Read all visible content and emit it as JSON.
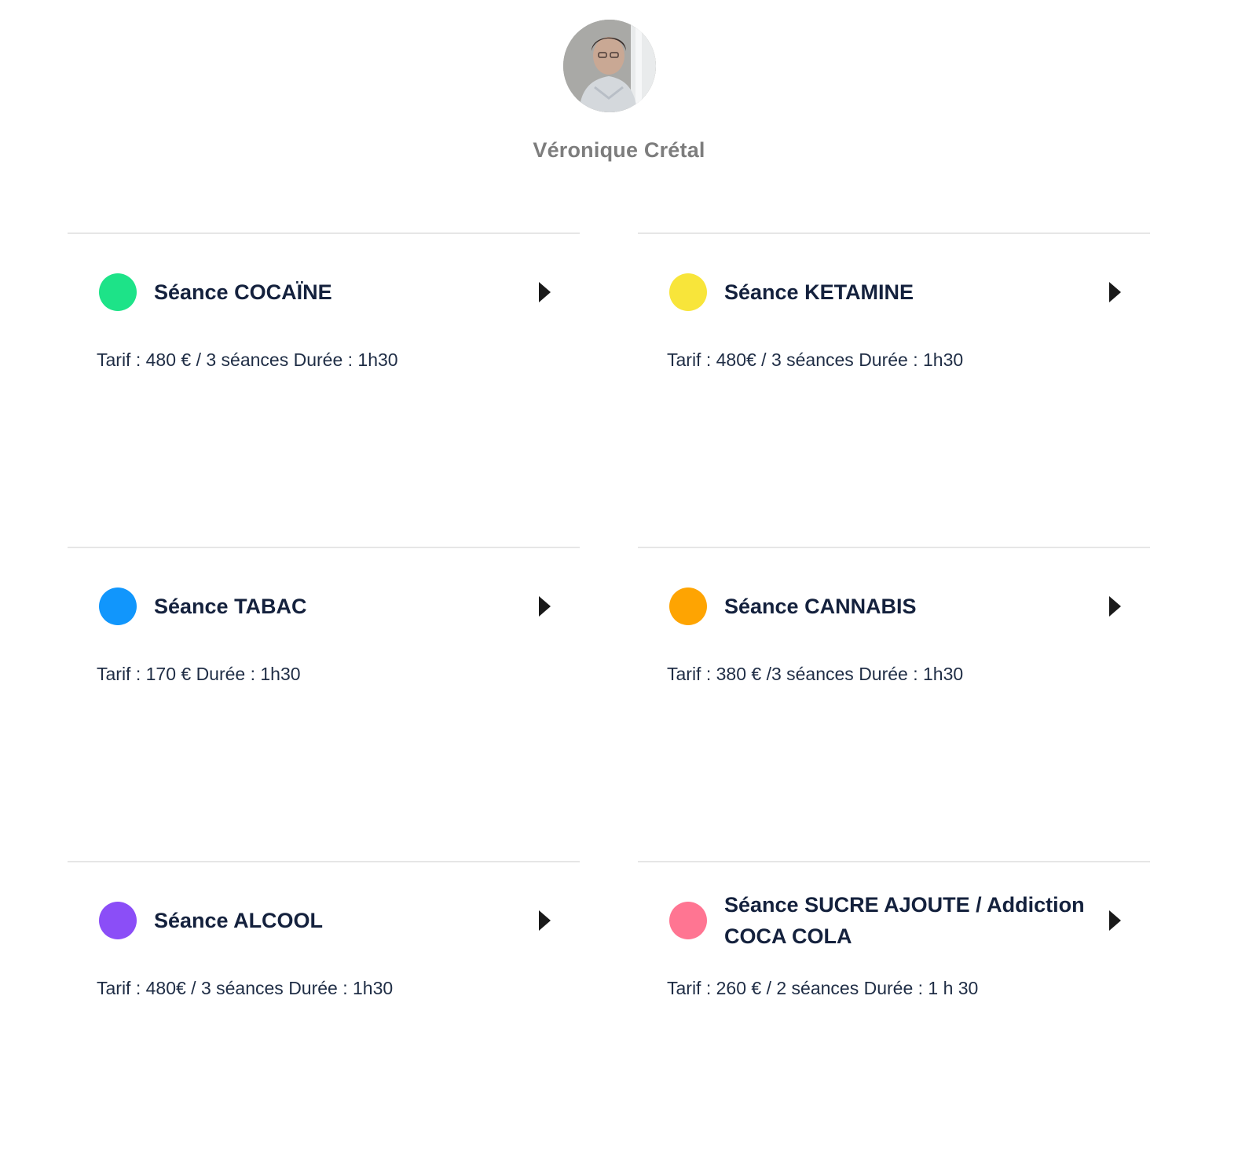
{
  "provider": {
    "name": "Véronique Crétal"
  },
  "services": [
    {
      "title": "Séance COCAÏNE",
      "description": "Tarif : 480 € / 3 séances Durée : 1h30",
      "dot_color": "#1de388",
      "icon": "chevron-right-icon"
    },
    {
      "title": "Séance KETAMINE",
      "description": "Tarif : 480€ / 3 séances Durée : 1h30",
      "dot_color": "#f8e53a",
      "icon": "chevron-right-icon"
    },
    {
      "title": "Séance TABAC",
      "description": "Tarif : 170 € Durée : 1h30",
      "dot_color": "#1196fc",
      "icon": "chevron-right-icon"
    },
    {
      "title": "Séance CANNABIS",
      "description": "Tarif : 380 € /3 séances Durée : 1h30",
      "dot_color": "#fea402",
      "icon": "chevron-right-icon"
    },
    {
      "title": "Séance ALCOOL",
      "description": "Tarif : 480€ / 3 séances Durée : 1h30",
      "dot_color": "#8b4ef7",
      "icon": "chevron-right-icon"
    },
    {
      "title": "Séance SUCRE AJOUTE / Addiction COCA COLA",
      "description": "Tarif : 260 € / 2 séances Durée : 1 h 30",
      "dot_color": "#ff7592",
      "icon": "chevron-right-icon"
    }
  ]
}
